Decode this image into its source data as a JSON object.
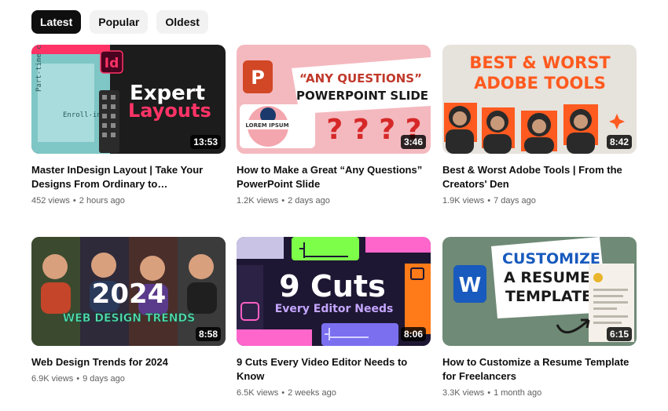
{
  "filters": {
    "latest": "Latest",
    "popular": "Popular",
    "oldest": "Oldest",
    "selected": "Latest"
  },
  "videos": [
    {
      "title": "Master InDesign Layout | Take Your Designs From Ordinary to…",
      "views": "452 views",
      "age": "2 hours ago",
      "duration": "13:53",
      "thumb": {
        "badge": "Id",
        "line1": "Expert",
        "line2": "Layouts",
        "doc_text_1": "Part-time courses",
        "doc_text_2": "Enroll-ing:"
      }
    },
    {
      "title": "How to Make a Great “Any Questions” PowerPoint Slide",
      "views": "1.2K views",
      "age": "2 days ago",
      "duration": "3:46",
      "thumb": {
        "badge": "P",
        "line1": "“ANY QUESTIONS”",
        "line2": "POWERPOINT SLIDE",
        "tag": "LOREM IPSUM",
        "marks": "? ? ? ?"
      }
    },
    {
      "title": "Best & Worst Adobe Tools | From the Creators' Den",
      "views": "1.9K views",
      "age": "7 days ago",
      "duration": "8:42",
      "thumb": {
        "line1": "BEST & WORST",
        "line2": "ADOBE TOOLS"
      }
    },
    {
      "title": "Web Design Trends for 2024",
      "views": "6.9K views",
      "age": "9 days ago",
      "duration": "8:58",
      "thumb": {
        "line1": "2024",
        "line2": "WEB DESIGN TRENDS"
      }
    },
    {
      "title": "9 Cuts Every Video Editor Needs to Know",
      "views": "6.5K views",
      "age": "2 weeks ago",
      "duration": "8:06",
      "thumb": {
        "line1": "9 Cuts",
        "line2": "Every Editor Needs"
      }
    },
    {
      "title": "How to Customize a Resume Template for Freelancers",
      "views": "3.3K views",
      "age": "1 month ago",
      "duration": "6:15",
      "thumb": {
        "badge": "W",
        "line1": "CUSTOMIZE",
        "line2": "A RESUME",
        "line3": "TEMPLATE"
      }
    }
  ],
  "colors": {
    "chip_active_bg": "#0f0f0f",
    "chip_bg": "#f2f2f2",
    "meta_text": "#606060",
    "indesign_pink": "#ff3366",
    "powerpoint_orange": "#d24726",
    "word_blue": "#185abd",
    "premiere_purple": "#9999ff"
  }
}
